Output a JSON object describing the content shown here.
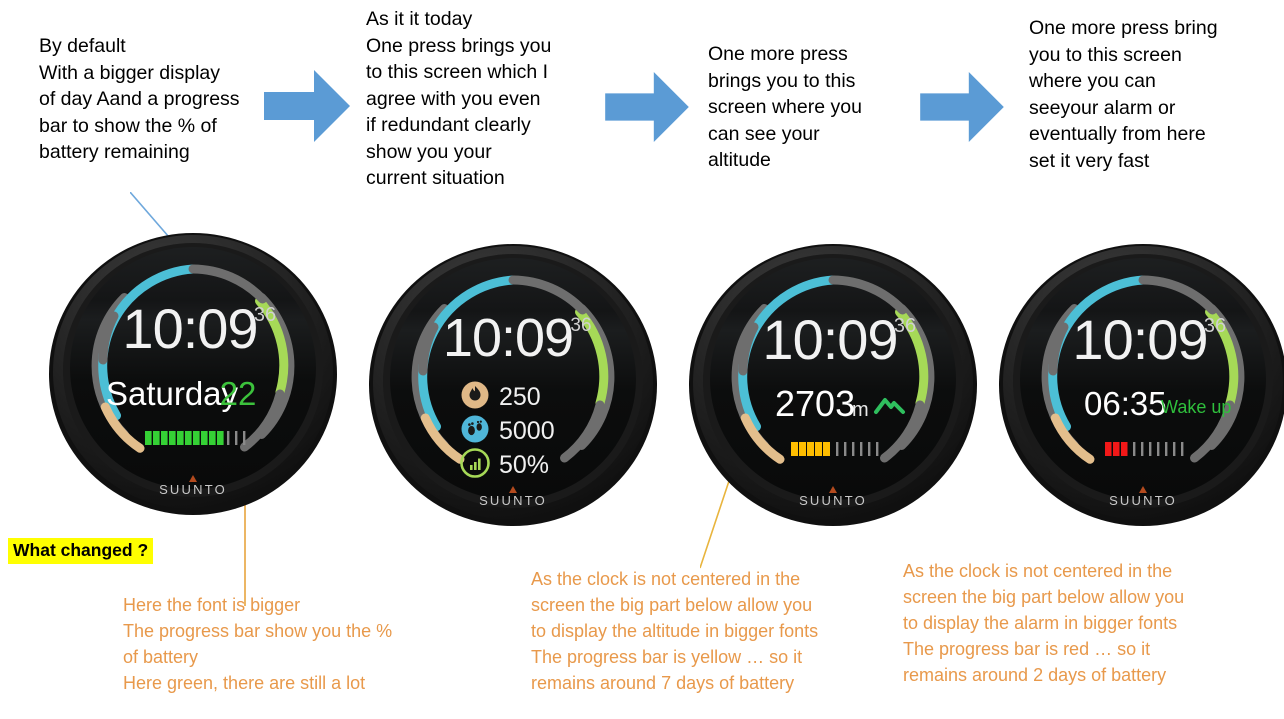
{
  "page": {
    "background": "#ffffff",
    "arrow_color": "#5B9BD5",
    "note_color": "#000000",
    "orange_note_color": "#E8994B",
    "highlight_bg": "#FFFF00"
  },
  "top_notes": [
    {
      "id": "note-default",
      "text": "By default\nWith a bigger display\nof day Aand a progress\nbar to show the % of\nbattery remaining"
    },
    {
      "id": "note-today",
      "text": "As it it today\nOne press brings you\nto this screen which I\nagree with you even\nif redundant clearly\nshow you your\ncurrent situation"
    },
    {
      "id": "note-altitude",
      "text": "One more press\nbrings you to this\nscreen where you\ncan see your\naltitude"
    },
    {
      "id": "note-alarm",
      "text": "One more press bring\nyou to this screen\nwhere you can\nseeyour alarm or\neventually from here\nset it very fast"
    }
  ],
  "arrows": [
    {
      "id": "arrow-1",
      "label": "right-arrow"
    },
    {
      "id": "arrow-2",
      "label": "right-arrow"
    },
    {
      "id": "arrow-3",
      "label": "right-arrow"
    }
  ],
  "highlight": {
    "label": "What changed ?"
  },
  "bottom_notes": [
    {
      "id": "onote-battery",
      "text": "Here the font is bigger\nThe progress bar show you the %\nof battery\nHere green, there are still a lot"
    },
    {
      "id": "onote-altitude",
      "text": "As the clock is not centered in the\nscreen the big part below allow you\nto display the altitude in bigger fonts\nThe progress bar is yellow … so it\nremains around 7 days of battery"
    },
    {
      "id": "onote-alarm",
      "text": "As the clock is not centered in the\nscreen the big part below allow you\nto display the alarm in bigger fonts\nThe progress bar is red … so it\nremains around 2 days of battery"
    }
  ],
  "watches": [
    {
      "id": "watch-default",
      "brand": "SUUNTO",
      "time": "10:09",
      "seconds": "36",
      "layout": "day",
      "day_label": "Saturday",
      "day_number": "22",
      "day_number_color": "#3CC23C",
      "battery_bar": {
        "color": "#35D135",
        "filled": 10,
        "total": 14
      },
      "arcs": {
        "cyan": "#4CBFD6",
        "green": "#A6D957",
        "tan": "#E3BE8C",
        "grey": "#6E6E6E"
      }
    },
    {
      "id": "watch-today",
      "brand": "SUUNTO",
      "time": "10:09",
      "seconds": "36",
      "layout": "stats",
      "stats": [
        {
          "icon": "flame-icon",
          "icon_color": "#E0B887",
          "value": "250"
        },
        {
          "icon": "footsteps-icon",
          "icon_color": "#4FB6D9",
          "value": "5000"
        },
        {
          "icon": "activity-bars-icon",
          "icon_color": "#A6D957",
          "value": "50%"
        }
      ],
      "arcs": {
        "cyan": "#4CBFD6",
        "green": "#A6D957",
        "tan": "#E3BE8C",
        "grey": "#6E6E6E"
      }
    },
    {
      "id": "watch-altitude",
      "brand": "SUUNTO",
      "time": "10:09",
      "seconds": "36",
      "layout": "altitude",
      "altitude_value": "2703",
      "altitude_unit": "m",
      "altitude_icon": "mountain-icon",
      "altitude_icon_color": "#2FBF5E",
      "battery_bar": {
        "color": "#FFBE00",
        "filled": 5,
        "total": 12
      },
      "arcs": {
        "cyan": "#4CBFD6",
        "green": "#A6D957",
        "tan": "#E3BE8C",
        "grey": "#6E6E6E"
      }
    },
    {
      "id": "watch-alarm",
      "brand": "SUUNTO",
      "time": "10:09",
      "seconds": "36",
      "layout": "alarm",
      "alarm_time": "06:35",
      "alarm_label": "Wake up",
      "alarm_label_color": "#2FBF3C",
      "battery_bar": {
        "color": "#F21818",
        "filled": 3,
        "total": 12
      },
      "arcs": {
        "cyan": "#4CBFD6",
        "green": "#A6D957",
        "tan": "#E3BE8C",
        "grey": "#6E6E6E"
      }
    }
  ]
}
